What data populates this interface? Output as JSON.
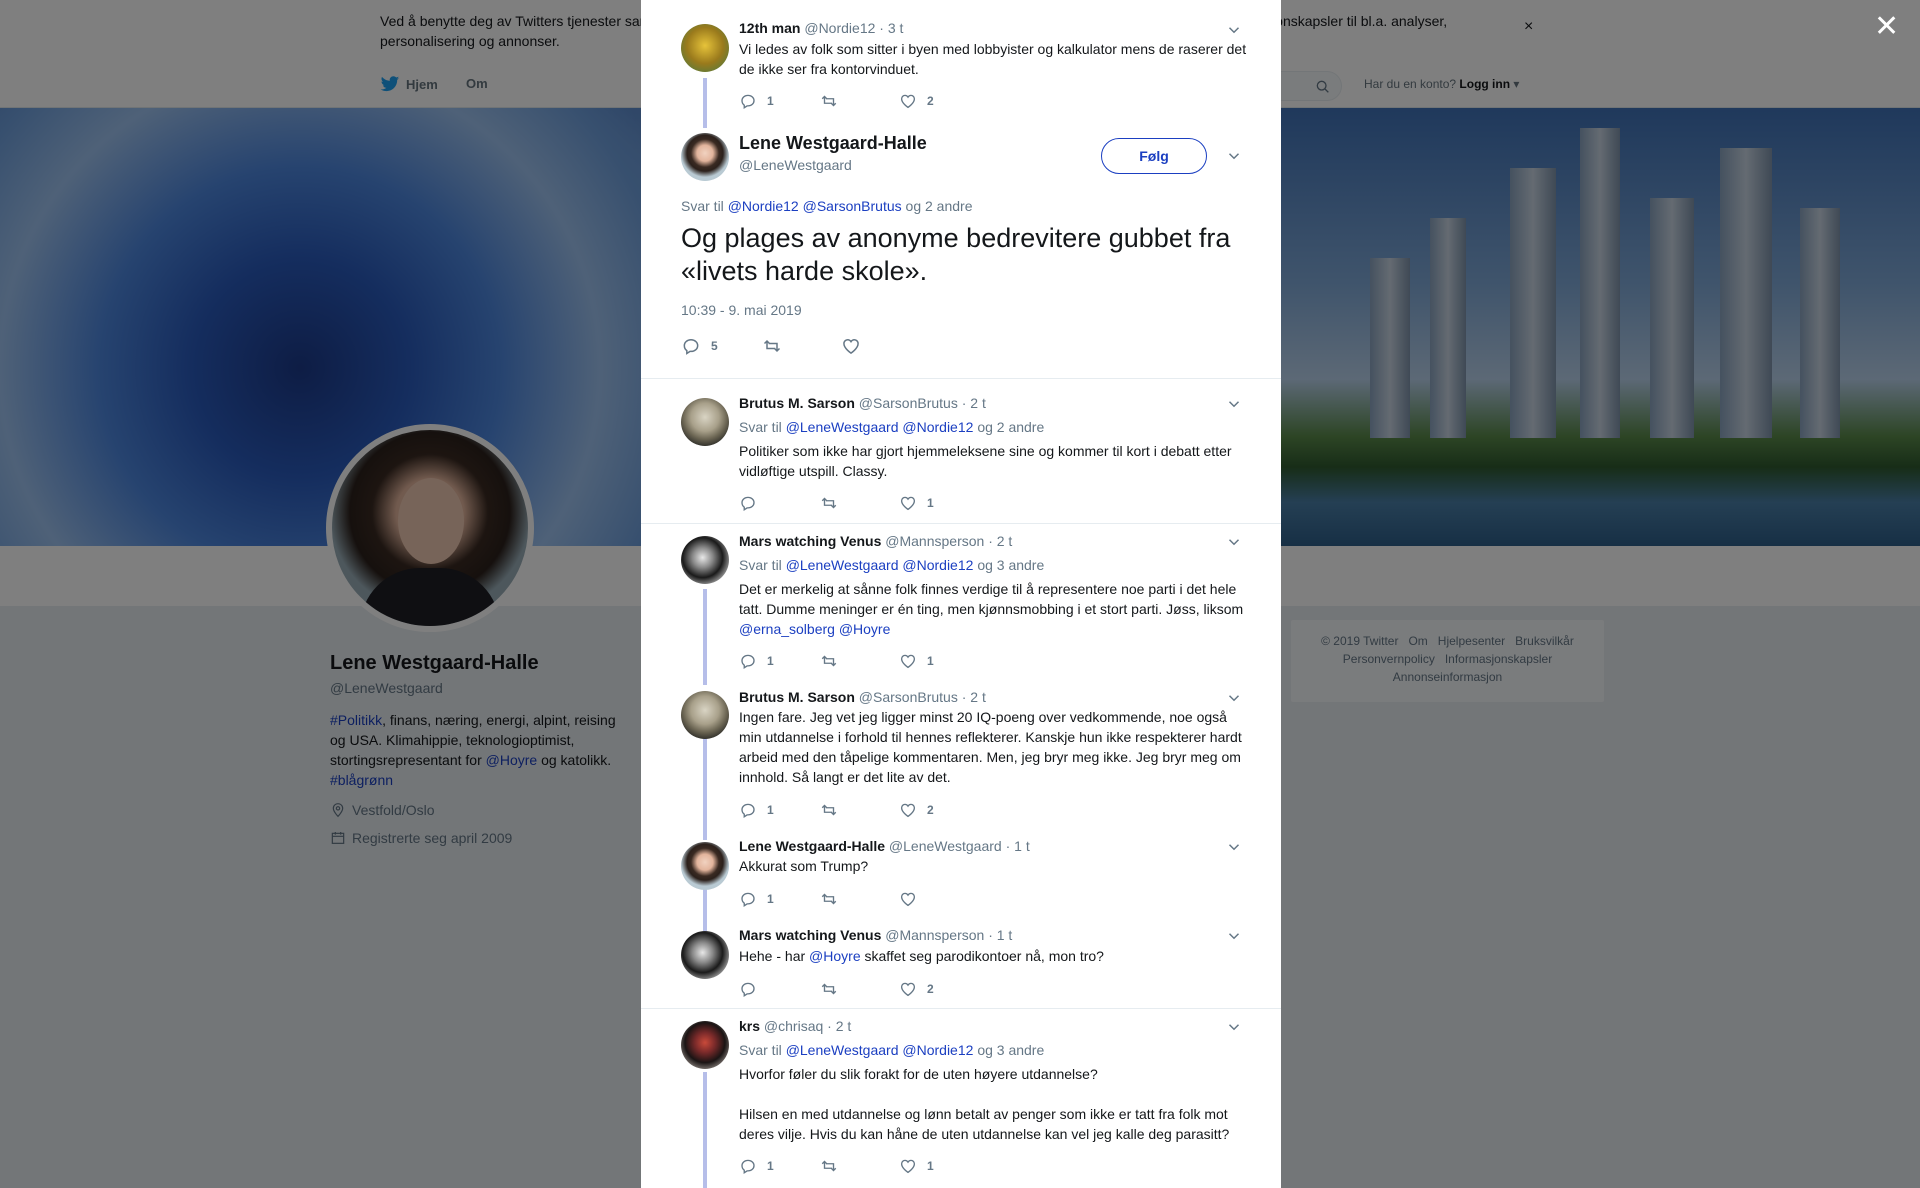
{
  "cookie": {
    "text": "Ved å benytte deg av Twitters tjenester samtykker du til vår bruk av informasjonskapsler. Vi og våre partnere opererer globalt og bruker informasjonskapsler til bl.a. analyser, personalisering og annonser.",
    "close": "×"
  },
  "nav": {
    "home": "Hjem",
    "about": "Om",
    "account_prompt": "Har du en konto?",
    "login": "Logg inn"
  },
  "profile": {
    "name": "Lene Westgaard-Halle",
    "handle": "@LeneWestgaard",
    "bio_tag1": "#Politikk",
    "bio_mid": ", finans, næring, energi, alpint, reising og USA. Klimahippie, teknologioptimist, stortingsrepresentant for ",
    "bio_mention": "@Hoyre",
    "bio_mid2": " og katolikk. ",
    "bio_tag2": "#blågrønn",
    "location": "Vestfold/Oslo",
    "joined": "Registrerte seg april 2009"
  },
  "footer": {
    "links": [
      "© 2019 Twitter",
      "Om",
      "Hjelpesenter",
      "Bruksvilkår",
      "Personvernpolicy",
      "Informasjonskapsler",
      "Annonseinformasjon"
    ]
  },
  "overlay_close": "✕",
  "parent": {
    "name": "12th man",
    "handle": "@Nordie12",
    "time": "· 3 t",
    "text": "Vi ledes av folk som sitter i byen med lobbyister og kalkulator mens de raserer det de ikke ser fra kontorvinduet.",
    "replies": "1",
    "likes": "2"
  },
  "main": {
    "name": "Lene Westgaard-Halle",
    "handle": "@LeneWestgaard",
    "follow": "Følg",
    "reply_prefix": "Svar til",
    "reply_m1": "@Nordie12",
    "reply_m2": "@SarsonBrutus",
    "reply_suffix": "og 2 andre",
    "text": "Og plages av anonyme bedrevitere gubbet fra «livets harde skole».",
    "date": "10:39 - 9. mai 2019",
    "replies": "5"
  },
  "replies": [
    {
      "name": "Brutus M. Sarson",
      "handle": "@SarsonBrutus",
      "time": "· 2 t",
      "reply_prefix": "Svar til",
      "reply_m1": "@LeneWestgaard",
      "reply_m2": "@Nordie12",
      "reply_suffix": "og 2 andre",
      "text": "Politiker som ikke har gjort hjemmeleksene sine og kommer til kort i debatt etter vidløftige utspill. Classy.",
      "replies": "",
      "likes": "1"
    },
    {
      "name": "Mars watching Venus",
      "handle": "@Mannsperson",
      "time": "· 2 t",
      "reply_prefix": "Svar til",
      "reply_m1": "@LeneWestgaard",
      "reply_m2": "@Nordie12",
      "reply_suffix": "og 3 andre",
      "text": "Det er merkelig at sånne folk finnes verdige til å representere noe parti i det hele tatt. Dumme meninger er én ting, men kjønnsmobbing i et stort parti. Jøss, liksom ",
      "text_m1": "@erna_solberg",
      "text_m2": "@Hoyre",
      "replies": "1",
      "likes": "1"
    },
    {
      "name": "Brutus M. Sarson",
      "handle": "@SarsonBrutus",
      "time": "· 2 t",
      "text": "Ingen fare. Jeg vet jeg ligger minst 20 IQ-poeng over vedkommende, noe også min utdannelse i forhold til hennes reflekterer. Kanskje hun ikke respekterer hardt arbeid med den tåpelige kommentaren. Men, jeg bryr meg ikke. Jeg bryr meg om innhold. Så langt er det lite av det.",
      "replies": "1",
      "likes": "2"
    },
    {
      "name": "Lene Westgaard-Halle",
      "handle": "@LeneWestgaard",
      "time": "· 1 t",
      "text": "Akkurat som Trump?",
      "replies": "1",
      "likes": ""
    },
    {
      "name": "Mars watching Venus",
      "handle": "@Mannsperson",
      "time": "· 1 t",
      "text_pre": "Hehe - har ",
      "text_m1": "@Hoyre",
      "text_post": " skaffet seg parodikontoer nå, mon tro?",
      "replies": "",
      "likes": "2"
    },
    {
      "name": "krs",
      "handle": "@chrisaq",
      "time": "· 2 t",
      "reply_prefix": "Svar til",
      "reply_m1": "@LeneWestgaard",
      "reply_m2": "@Nordie12",
      "reply_suffix": "og 3 andre",
      "text_p1": "Hvorfor føler du slik forakt for de uten høyere utdannelse?",
      "text_p2": "Hilsen en med utdannelse og lønn betalt av penger som ikke er tatt fra folk mot deres vilje. Hvis du kan håne de uten utdannelse kan vel jeg kalle deg parasitt?",
      "replies": "1",
      "likes": "1"
    }
  ],
  "colors": {
    "link": "#1b3fc1",
    "thread": "#b6bee9",
    "muted": "#657786"
  }
}
